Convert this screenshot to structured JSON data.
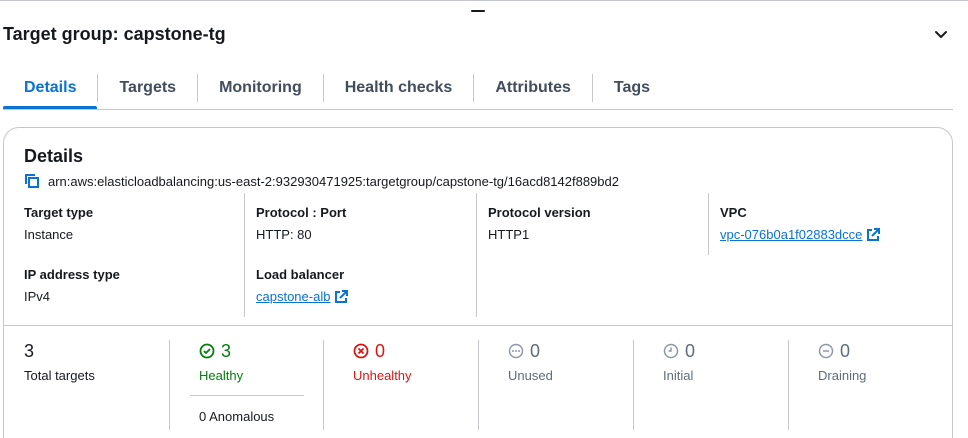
{
  "header": {
    "title": "Target group: capstone-tg",
    "collapse_icon": "chevron-down-icon"
  },
  "tabs": [
    {
      "label": "Details",
      "active": true
    },
    {
      "label": "Targets",
      "active": false
    },
    {
      "label": "Monitoring",
      "active": false
    },
    {
      "label": "Health checks",
      "active": false
    },
    {
      "label": "Attributes",
      "active": false
    },
    {
      "label": "Tags",
      "active": false
    }
  ],
  "details": {
    "title": "Details",
    "arn": "arn:aws:elasticloadbalancing:us-east-2:932930471925:targetgroup/capstone-tg/16acd8142f889bd2",
    "fields": {
      "target_type": {
        "key": "Target type",
        "value": "Instance"
      },
      "protocol_port": {
        "key": "Protocol : Port",
        "value": "HTTP: 80"
      },
      "protocol_version": {
        "key": "Protocol version",
        "value": "HTTP1"
      },
      "vpc": {
        "key": "VPC",
        "value": "vpc-076b0a1f02883dcce"
      },
      "ip_address_type": {
        "key": "IP address type",
        "value": "IPv4"
      },
      "load_balancer": {
        "key": "Load balancer",
        "value": "capstone-alb"
      }
    }
  },
  "stats": {
    "total": {
      "count": "3",
      "label": "Total targets"
    },
    "healthy": {
      "count": "3",
      "label": "Healthy",
      "color": "#037f0c"
    },
    "unhealthy": {
      "count": "0",
      "label": "Unhealthy",
      "color": "#d91515"
    },
    "unused": {
      "count": "0",
      "label": "Unused"
    },
    "initial": {
      "count": "0",
      "label": "Initial"
    },
    "draining": {
      "count": "0",
      "label": "Draining"
    },
    "anomalous": "0 Anomalous"
  },
  "colors": {
    "accent": "#0972d3",
    "healthy": "#037f0c",
    "unhealthy": "#d91515",
    "neutral": "#5f6b7a"
  }
}
